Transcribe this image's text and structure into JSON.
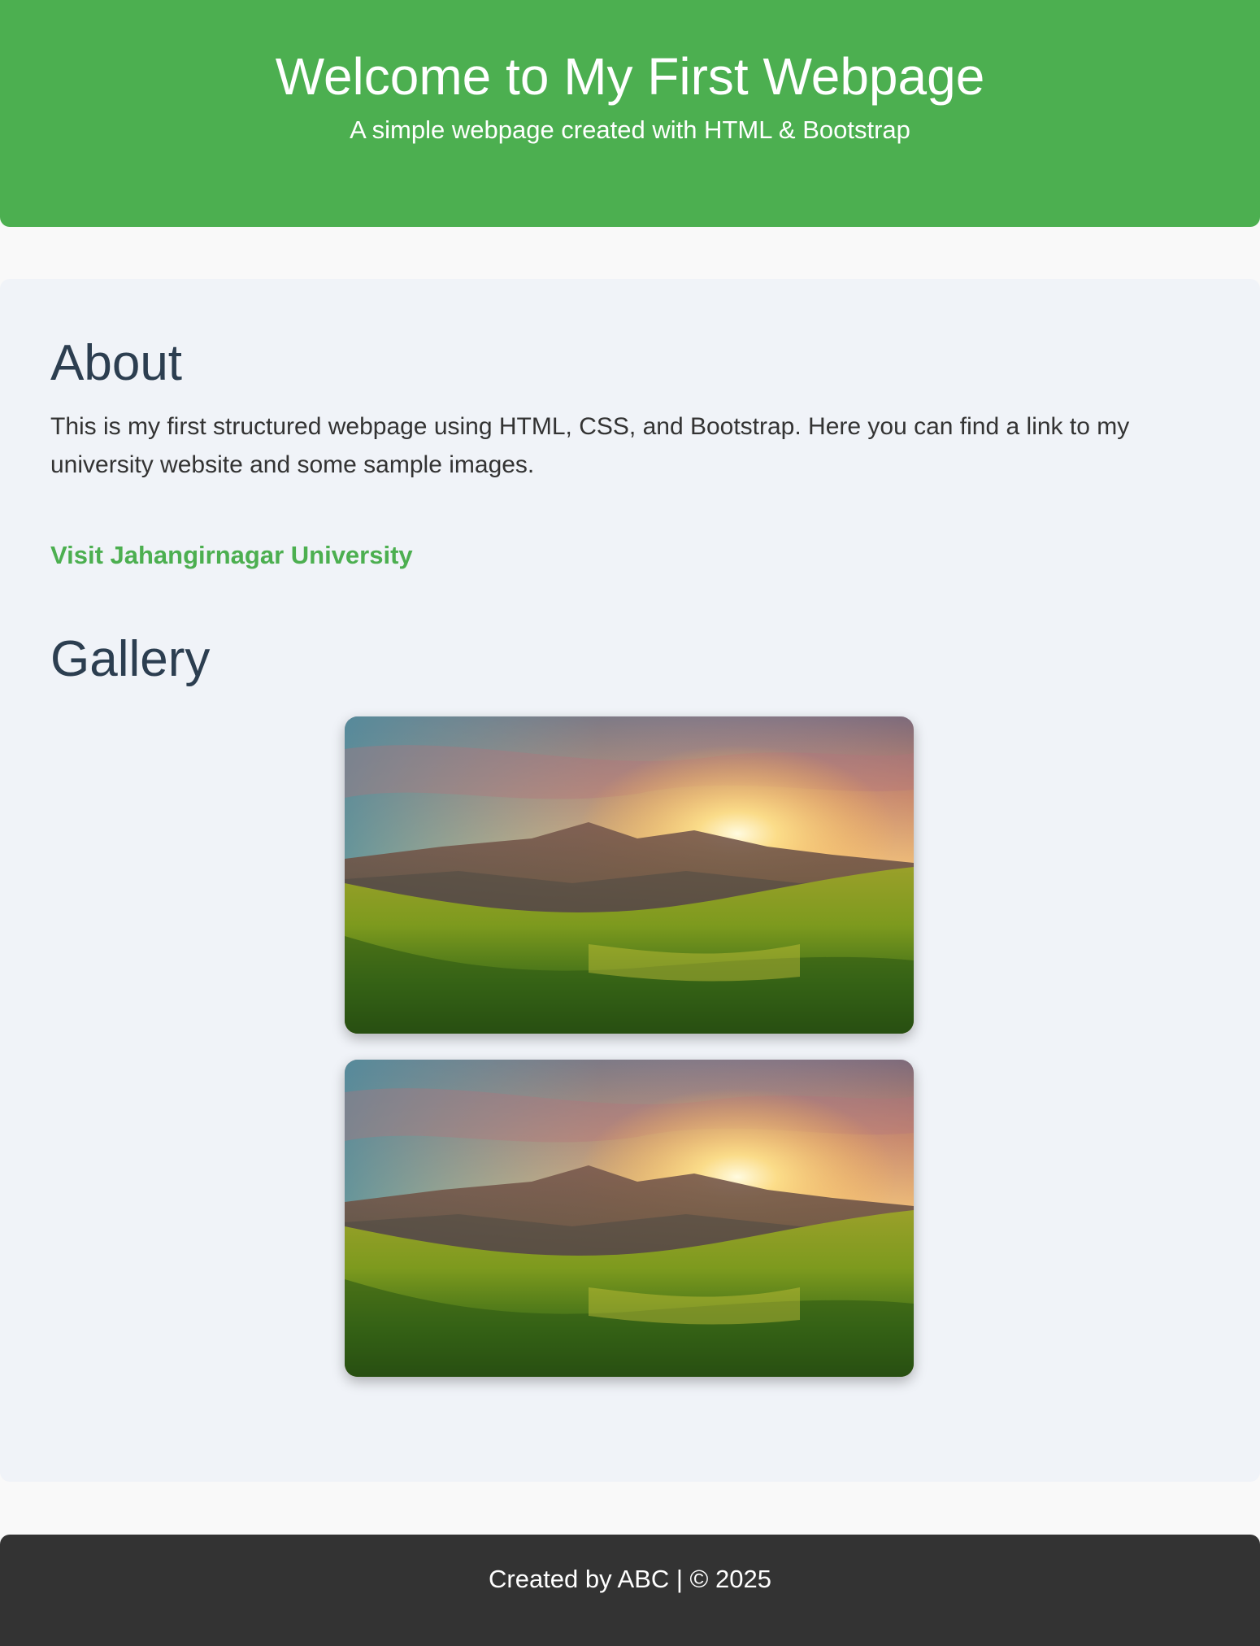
{
  "header": {
    "title": "Welcome to My First Webpage",
    "subtitle": "A simple webpage created with HTML & Bootstrap"
  },
  "about": {
    "heading": "About",
    "text": "This is my first structured webpage using HTML, CSS, and Bootstrap. Here you can find a link to my university website and some sample images.",
    "link_label": "Visit Jahangirnagar University"
  },
  "gallery": {
    "heading": "Gallery",
    "images": [
      {
        "subject": "sunset-over-grassy-hills"
      },
      {
        "subject": "sunset-over-grassy-hills"
      }
    ]
  },
  "footer": {
    "text": "Created by ABC | © 2025"
  },
  "colors": {
    "header_bg": "#4caf50",
    "link": "#4caf50",
    "main_bg": "#f0f3f8",
    "heading": "#2c3e50",
    "footer_bg": "#333333"
  }
}
